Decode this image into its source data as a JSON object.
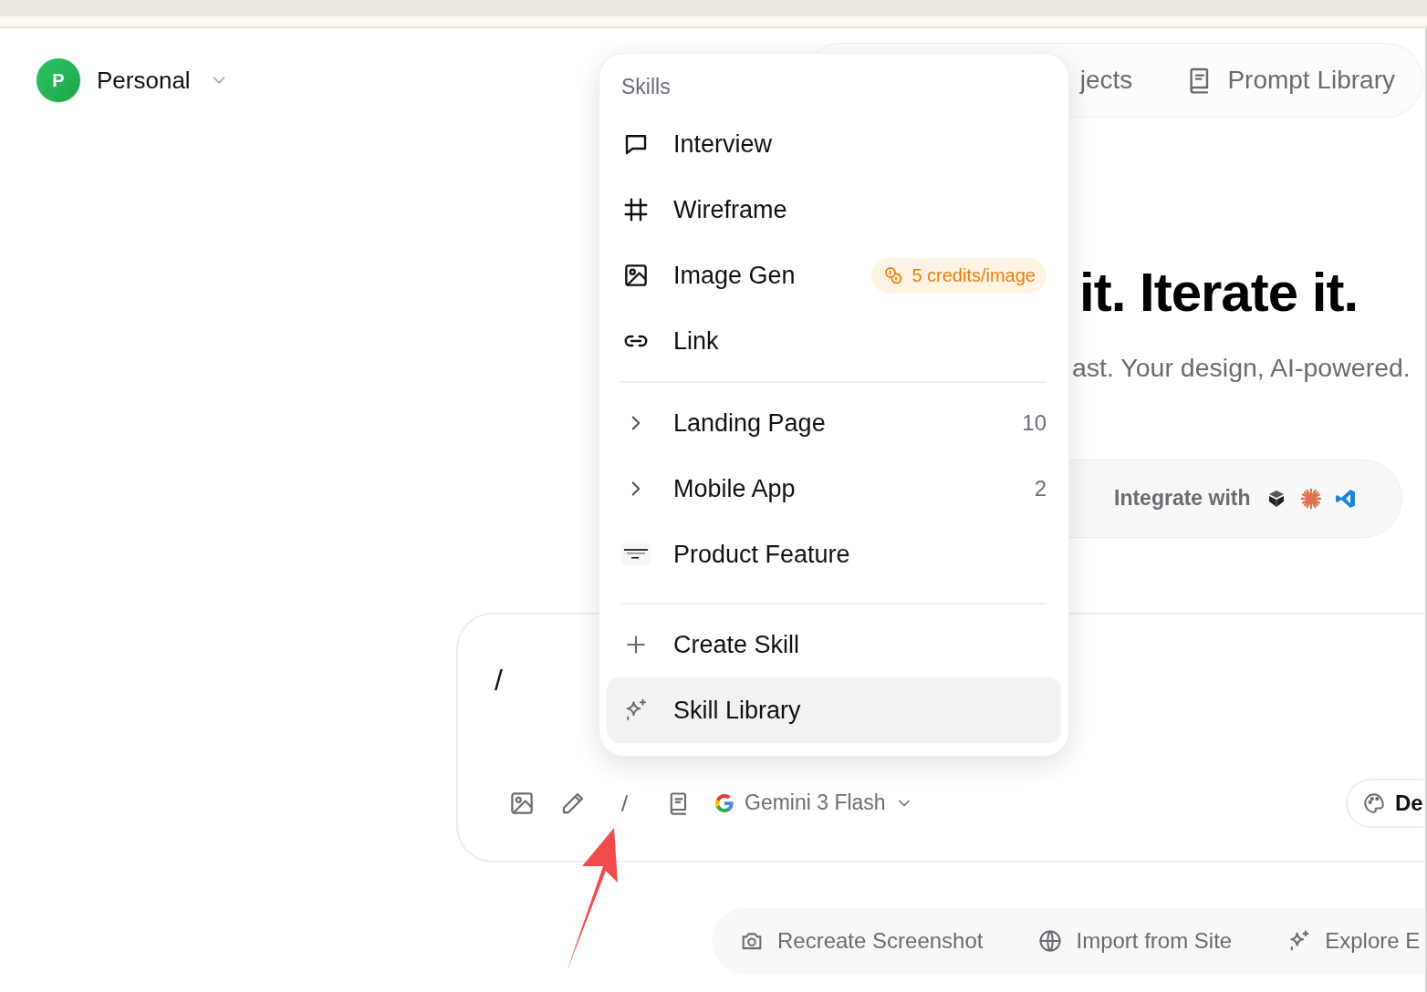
{
  "workspace": {
    "initial": "P",
    "name": "Personal"
  },
  "nav": [
    {
      "label": "jects"
    },
    {
      "label": "Prompt Library"
    }
  ],
  "hero": {
    "title": "it. Iterate it.",
    "subtitle": "ast. Your design, AI-powered."
  },
  "integrate": {
    "label": "Integrate with"
  },
  "prompt": {
    "value": "/",
    "model": "Gemini 3 Flash",
    "style_button": "De"
  },
  "suggestions": [
    {
      "label": "Recreate Screenshot"
    },
    {
      "label": "Import from Site"
    },
    {
      "label": "Explore E"
    }
  ],
  "skills_menu": {
    "title": "Skills",
    "sections": [
      {
        "items": [
          {
            "kind": "skill",
            "label": "Interview",
            "selected": false
          },
          {
            "kind": "skill",
            "label": "Wireframe",
            "selected": false
          },
          {
            "kind": "skill",
            "label": "Image Gen",
            "badge": "5 credits/image",
            "selected": false
          },
          {
            "kind": "skill",
            "label": "Link",
            "selected": false
          }
        ]
      },
      {
        "items": [
          {
            "kind": "group",
            "label": "Landing Page",
            "count": "10",
            "expanded": false,
            "selected": false
          },
          {
            "kind": "group",
            "label": "Mobile App",
            "count": "2",
            "expanded": false,
            "selected": false
          },
          {
            "kind": "skill",
            "label": "Product Feature",
            "selected": false
          }
        ]
      },
      {
        "items": [
          {
            "kind": "action",
            "label": "Create Skill",
            "selected": false
          },
          {
            "kind": "action",
            "label": "Skill Library",
            "selected": true
          }
        ]
      }
    ]
  }
}
